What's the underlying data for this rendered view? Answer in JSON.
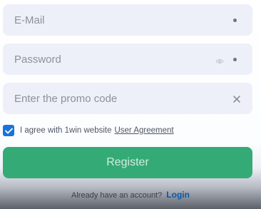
{
  "form": {
    "email": {
      "placeholder": "E-Mail",
      "value": ""
    },
    "password": {
      "placeholder": "Password",
      "value": ""
    },
    "promo": {
      "placeholder": "Enter the promo code",
      "value": ""
    },
    "agreement": {
      "checked": true,
      "text": "I agree with 1win website",
      "link_label": "User Agreement"
    },
    "register_label": "Register",
    "login_prompt": "Already have an account?",
    "login_label": "Login"
  },
  "icons": {
    "email_trailing": "dot-icon",
    "password_visibility": "eye-icon",
    "password_trailing": "dot-icon",
    "promo_clear": "close-icon",
    "checkbox_mark": "check-icon"
  },
  "colors": {
    "field_background": "#edf0f8",
    "checkbox": "#1a73d8",
    "register_button": "#34ab77",
    "login_link": "#0b57a8"
  }
}
